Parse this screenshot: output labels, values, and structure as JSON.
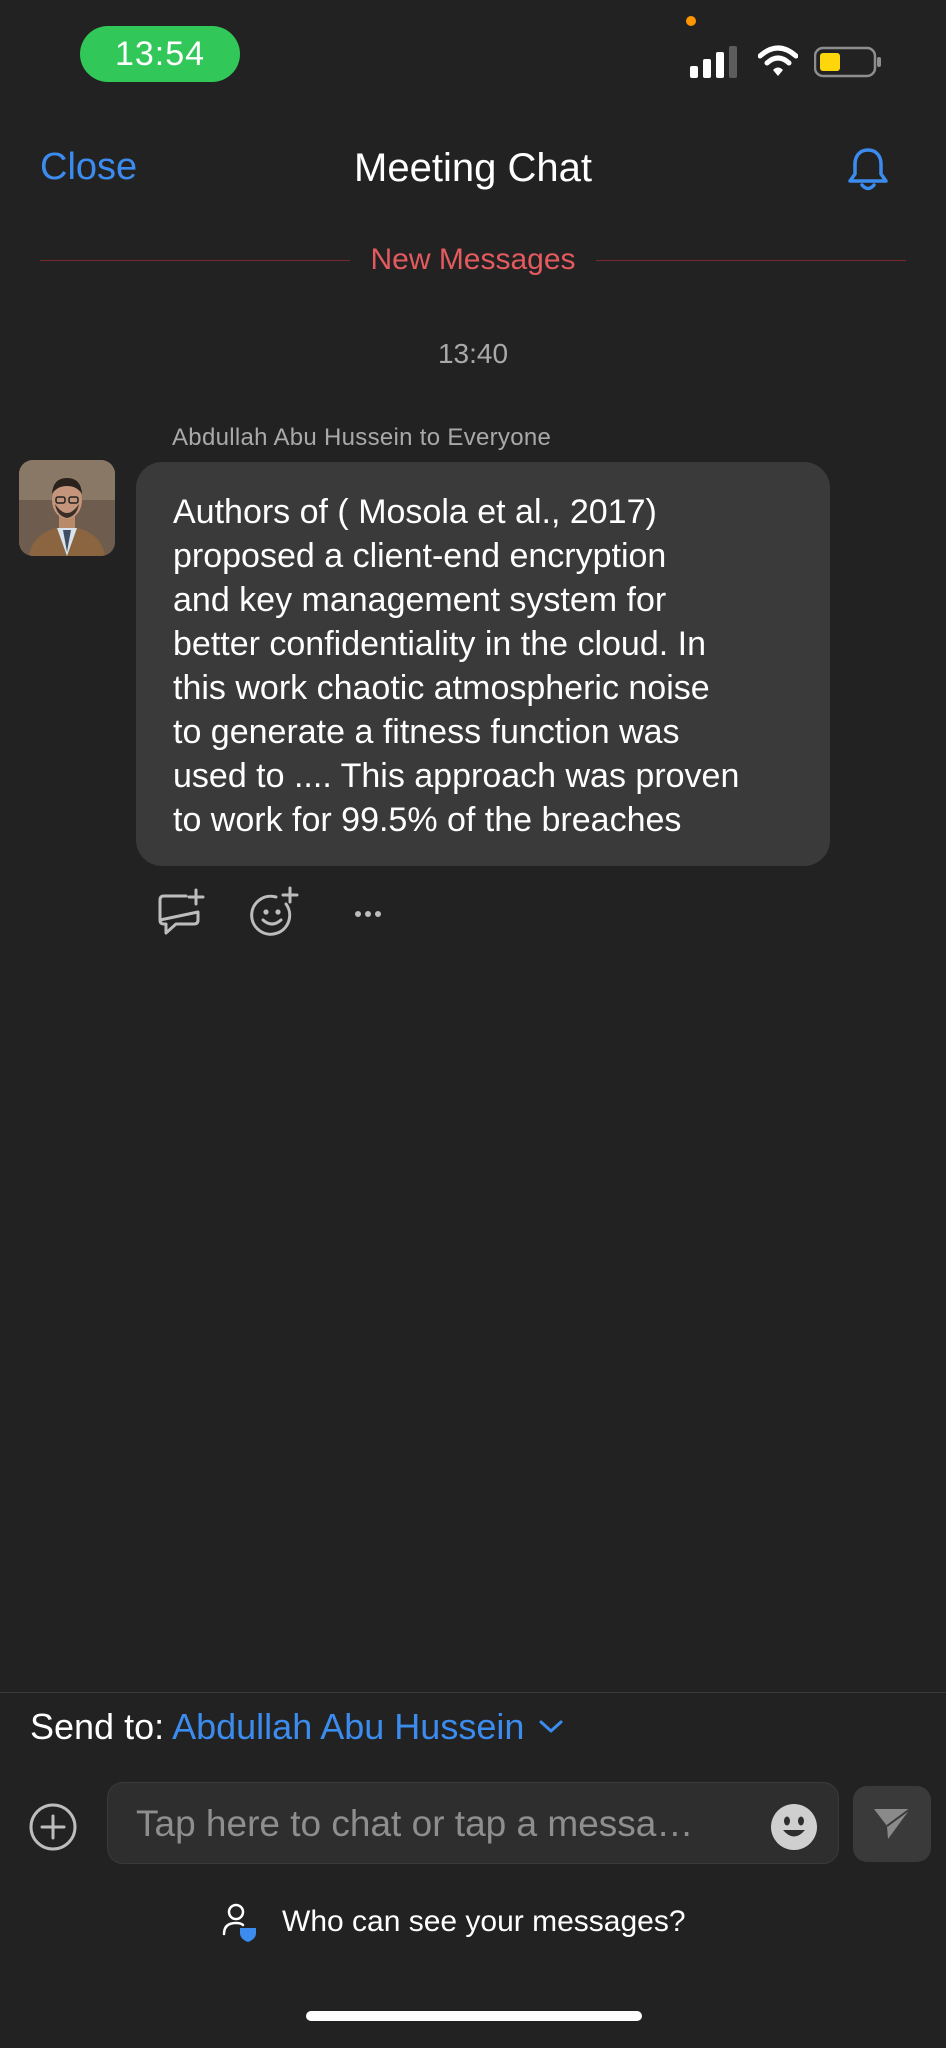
{
  "status_bar": {
    "time": "13:54"
  },
  "header": {
    "close_label": "Close",
    "title": "Meeting Chat"
  },
  "chat": {
    "new_messages_label": "New Messages",
    "timestamp": "13:40",
    "message": {
      "sender_line": "Abdullah Abu Hussein to Everyone",
      "text": "Authors of ( Mosola et al., 2017)\nproposed a client-end encryption\nand key management system  for\nbetter confidentiality in the cloud. In\nthis work chaotic atmospheric noise\nto generate a fitness function was\nused to .... This approach was proven\nto work for 99.5% of the breaches"
    },
    "actions": [
      "reply-icon",
      "add-reaction-icon",
      "more-icon"
    ]
  },
  "composer": {
    "send_to_label": "Send to:",
    "send_to_value": "Abdullah Abu Hussein",
    "placeholder": "Tap here to chat or tap a messa…",
    "privacy_label": "Who can see your messages?"
  },
  "colors": {
    "accent": "#3c8cf0",
    "new_messages": "#e35a5f",
    "background": "#222222",
    "bubble": "#3a3a3a",
    "time_pill": "#32c759"
  }
}
